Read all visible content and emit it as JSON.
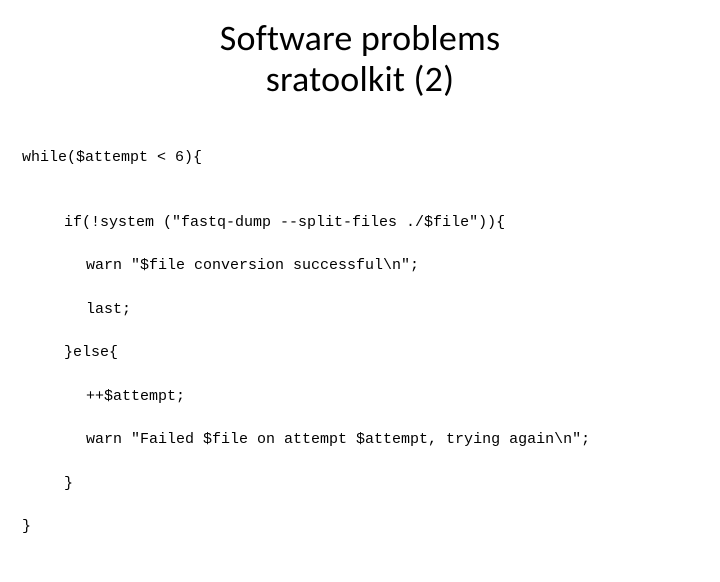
{
  "title": {
    "line1": "Software problems",
    "line2": "sratoolkit (2)"
  },
  "code": {
    "l1": "while($attempt < 6){",
    "l2": "",
    "l3": "if(!system (\"fastq-dump --split-files ./$file\")){",
    "l4": "warn \"$file conversion successful\\n\";",
    "l5": "last;",
    "l6": "}else{",
    "l7": "++$attempt;",
    "l8": "warn \"Failed $file on attempt $attempt, trying again\\n\";",
    "l9": "}",
    "l10": "}"
  }
}
